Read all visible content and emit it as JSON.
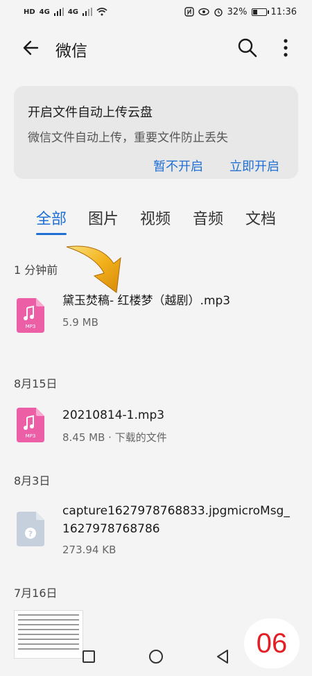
{
  "status_bar": {
    "left_badges": [
      "HD",
      "4G",
      "4G"
    ],
    "battery_percent": "32%",
    "battery_level": 0.32,
    "time": "11:36"
  },
  "app_bar": {
    "title": "微信",
    "icons": {
      "back": "arrow-left",
      "search": "magnifier",
      "more": "vertical-dots"
    }
  },
  "banner": {
    "title": "开启文件自动上传云盘",
    "subtitle": "微信文件自动上传，重要文件防止丢失",
    "secondary_button": "暂不开启",
    "primary_button": "立即开启"
  },
  "tabs": [
    {
      "label": "全部",
      "active": true
    },
    {
      "label": "图片",
      "active": false
    },
    {
      "label": "视频",
      "active": false
    },
    {
      "label": "音频",
      "active": false
    },
    {
      "label": "文档",
      "active": false
    }
  ],
  "sections": [
    {
      "header": "1 分钟前",
      "files": [
        {
          "name": "黛玉焚稿- 红楼梦（越剧）.mp3",
          "meta": "5.9 MB",
          "icon_label": "MP3"
        }
      ]
    },
    {
      "header": "8月15日",
      "files": [
        {
          "name": "20210814-1.mp3",
          "meta": "8.45 MB · 下载的文件",
          "icon_label": "MP3"
        }
      ]
    },
    {
      "header": "8月3日",
      "files": [
        {
          "name": "capture1627978768833.jpgmicroMsg_1627978768786",
          "meta": "273.94 KB",
          "icon_label": "?"
        }
      ]
    },
    {
      "header": "7月16日",
      "files": []
    }
  ],
  "overlay": {
    "page_number": "06"
  },
  "colors": {
    "accent": "#1f6fd4",
    "mp3_icon": "#ec5fa7",
    "unknown_icon": "#c5d0dc",
    "page_number": "#e31e24"
  }
}
